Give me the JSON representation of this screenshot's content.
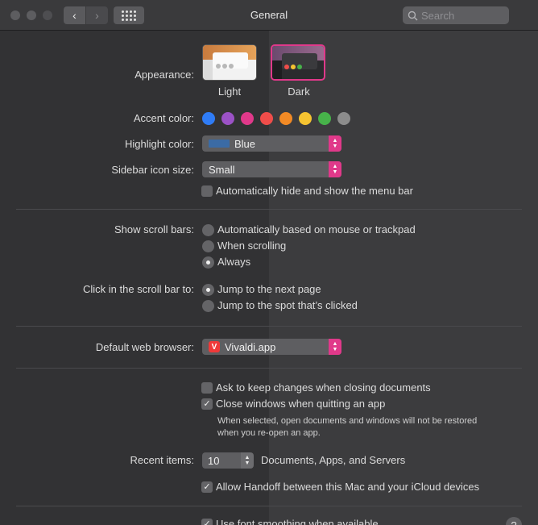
{
  "window": {
    "title": "General"
  },
  "toolbar": {
    "back_icon": "chevron-left-icon",
    "forward_icon": "chevron-right-icon",
    "show_all_icon": "grid-icon",
    "search_placeholder": "Search"
  },
  "appearance": {
    "label": "Appearance:",
    "options": [
      {
        "name": "Light",
        "selected": false
      },
      {
        "name": "Dark",
        "selected": true
      }
    ]
  },
  "accent": {
    "label": "Accent color:",
    "colors": [
      "#2f7cf6",
      "#9b52c6",
      "#e0398a",
      "#ef4d4a",
      "#f28a25",
      "#f6c431",
      "#47b24a",
      "#8c8c8c"
    ]
  },
  "highlight": {
    "label": "Highlight color:",
    "value": "Blue",
    "swatch": "#3b6ba5"
  },
  "sidebar_icon": {
    "label": "Sidebar icon size:",
    "value": "Small"
  },
  "menubar": {
    "label": "Automatically hide and show the menu bar",
    "checked": false
  },
  "scroll_bars": {
    "label": "Show scroll bars:",
    "options": [
      {
        "label": "Automatically based on mouse or trackpad",
        "selected": false
      },
      {
        "label": "When scrolling",
        "selected": false
      },
      {
        "label": "Always",
        "selected": true
      }
    ]
  },
  "click_scroll": {
    "label": "Click in the scroll bar to:",
    "options": [
      {
        "label": "Jump to the next page",
        "selected": true
      },
      {
        "label": "Jump to the spot that’s clicked",
        "selected": false
      }
    ]
  },
  "browser": {
    "label": "Default web browser:",
    "value": "Vivaldi.app",
    "icon_glyph": "V"
  },
  "docs": {
    "ask_keep": {
      "label": "Ask to keep changes when closing documents",
      "checked": false
    },
    "close_windows": {
      "label": "Close windows when quitting an app",
      "checked": true
    },
    "note_line1": "When selected, open documents and windows will not be restored",
    "note_line2": "when you re-open an app."
  },
  "recent": {
    "label": "Recent items:",
    "value": "10",
    "suffix": "Documents, Apps, and Servers"
  },
  "handoff": {
    "label": "Allow Handoff between this Mac and your iCloud devices",
    "checked": true
  },
  "font_smoothing": {
    "label": "Use font smoothing when available",
    "checked": true
  },
  "help": {
    "glyph": "?"
  },
  "glyphs": {
    "check": "✓",
    "up": "▲",
    "down": "▼",
    "back": "‹",
    "forward": "›"
  }
}
